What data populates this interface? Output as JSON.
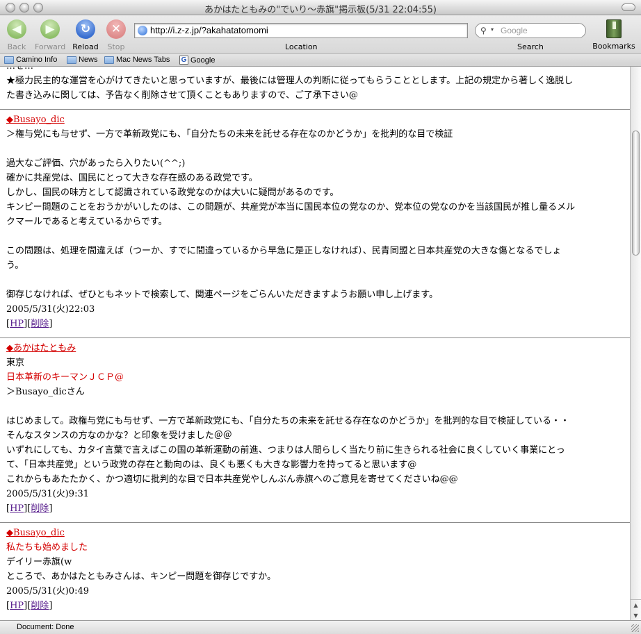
{
  "window": {
    "title": "あかはたともみの\"でいり～赤旗\"掲示板(5/31 22:04:55)"
  },
  "toolbar": {
    "back_label": "Back",
    "forward_label": "Forward",
    "reload_label": "Reload",
    "stop_label": "Stop",
    "url": "http://i.z-z.jp/?akahatatomomi",
    "location_label": "Location",
    "search_placeholder": "Google",
    "search_label": "Search",
    "bookmarks_label": "Bookmarks"
  },
  "bookmarks_bar": [
    "Camino Info",
    "News",
    "Mac News Tabs",
    "Google"
  ],
  "intro": {
    "line_partial": "…を…",
    "line1": "★極力民主的な運営を心がけてきたいと思っていますが、最後には管理人の判断に従ってもらうこととします。上記の規定から著しく逸脱し",
    "line2": "た書き込みに関しては、予告なく削除させて頂くこともありますので、ご了承下さい@"
  },
  "posts": [
    {
      "name": "◆Busayo_dic",
      "lines": [
        "＞権与党にも与せず、一方で革新政党にも、「自分たちの未来を託せる存在なのかどうか」を批判的な目で検証",
        "",
        "過大なご評価、穴があったら入りたい(^^;)",
        "確かに共産党は、国民にとって大きな存在感のある政党です。",
        "しかし、国民の味方として認識されている政党なのかは大いに疑問があるのです。",
        "キンピー問題のことをおうかがいしたのは、この問題が、共産党が本当に国民本位の党なのか、党本位の党なのかを当該国民が推し量るメル",
        "クマールであると考えているからです。",
        "",
        "この問題は、処理を間違えば（つーか、すでに間違っているから早急に是正しなければ）、民青同盟と日本共産党の大きな傷となるでしょ",
        "う。",
        "",
        "御存じなければ、ぜひともネットで検索して、関連ページをごらんいただきますようお願い申し上げます。"
      ],
      "date": "2005/5/31(火)22:03",
      "links": [
        "HP",
        "削除"
      ]
    },
    {
      "name": "◆あかはたともみ",
      "location": "東京",
      "subject": "日本革新のキーマンＪＣＰ@",
      "lines": [
        "＞Busayo_dicさん",
        "",
        "はじめまして。政権与党にも与せず、一方で革新政党にも、「自分たちの未来を託せる存在なのかどうか」を批判的な目で検証している・・",
        "そんなスタンスの方なのかな？と印象を受けました＠＠",
        "いずれにしても、カタイ言葉で言えばこの国の革新運動の前進、つまりは人間らしく当たり前に生きられる社会に良くしていく事業にとっ",
        "て、「日本共産党」という政党の存在と動向のは、良くも悪くも大きな影響力を持ってると思います@",
        "これからもあたたかく、かつ適切に批判的な目で日本共産党やしんぶん赤旗へのご意見を寄せてくださいね@@"
      ],
      "date": "2005/5/31(火)9:31",
      "links": [
        "HP",
        "削除"
      ]
    },
    {
      "name": "◆Busayo_dic",
      "subject": "私たちも始めました",
      "lines": [
        "デイリー赤旗(w",
        "ところで、あかはたともみさんは、キンピー問題を御存じですか。"
      ],
      "date": "2005/5/31(火)0:49",
      "links": [
        "HP",
        "削除"
      ]
    }
  ],
  "status": {
    "text": "Document: Done"
  },
  "colors": {
    "name_red": "#d40000",
    "visited_link": "#551a8b"
  }
}
